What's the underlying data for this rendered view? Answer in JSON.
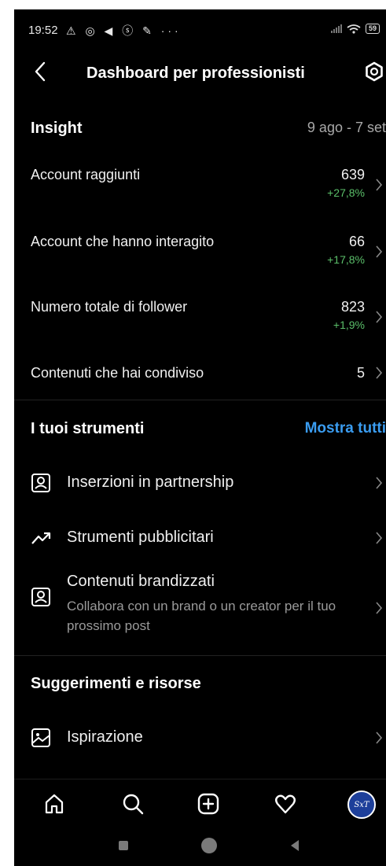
{
  "status": {
    "time": "19:52",
    "left_icons": "⚠ ◎ ◀ ⓢ ✎ ···",
    "battery": "59"
  },
  "header": {
    "title": "Dashboard per professionisti",
    "back_icon": "chevron-left-icon",
    "settings_icon": "gear-icon"
  },
  "insight": {
    "heading": "Insight",
    "date_range": "9 ago - 7 set",
    "metrics": [
      {
        "label": "Account raggiunti",
        "value": "639",
        "delta": "+27,8%"
      },
      {
        "label": "Account che hanno interagito",
        "value": "66",
        "delta": "+17,8%"
      },
      {
        "label": "Numero totale di follower",
        "value": "823",
        "delta": "+1,9%"
      },
      {
        "label": "Contenuti che hai condiviso",
        "value": "5",
        "delta": ""
      }
    ]
  },
  "tools": {
    "heading": "I tuoi strumenti",
    "show_all": "Mostra tutti",
    "items": [
      {
        "label": "Inserzioni in partnership",
        "subtitle": "",
        "icon": "person-badge-icon"
      },
      {
        "label": "Strumenti pubblicitari",
        "subtitle": "",
        "icon": "trending-up-icon"
      },
      {
        "label": "Contenuti brandizzati",
        "subtitle": "Collabora con un brand o un creator per il tuo prossimo post",
        "icon": "person-badge-icon"
      }
    ]
  },
  "resources": {
    "heading": "Suggerimenti e risorse",
    "items": [
      {
        "label": "Ispirazione",
        "icon": "image-icon"
      }
    ]
  },
  "bottom_nav": {
    "items": [
      "home-icon",
      "search-icon",
      "create-icon",
      "heart-icon",
      "profile-avatar"
    ],
    "avatar_text": "SxT"
  },
  "colors": {
    "background": "#000000",
    "accent": "#3a9cf0",
    "positive": "#5bbf6a",
    "muted": "#a8a8a8"
  }
}
